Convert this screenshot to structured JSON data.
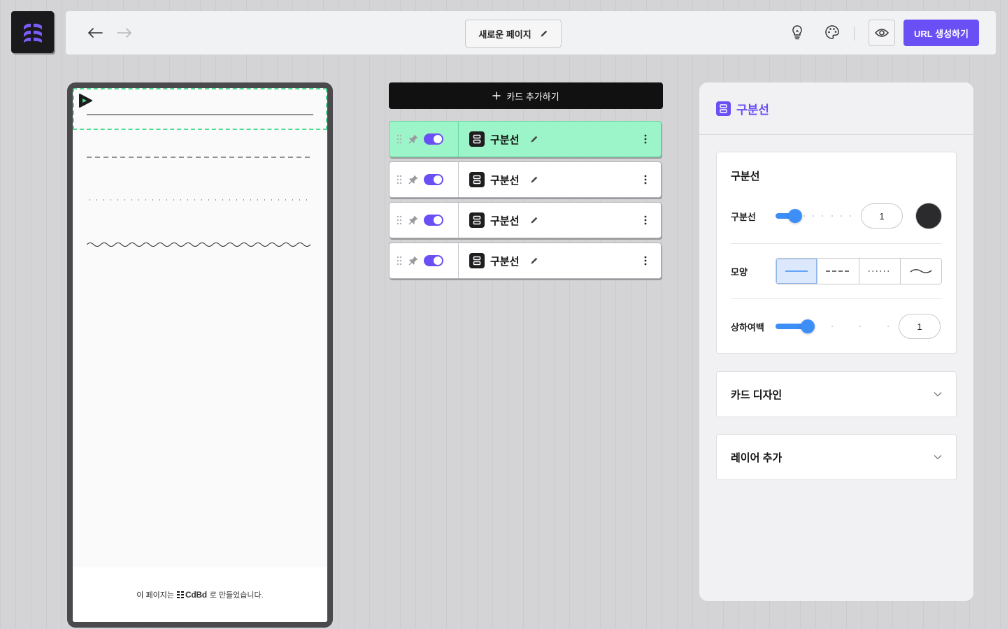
{
  "topbar": {
    "page_title": "새로운 페이지",
    "url_button": "URL 생성하기"
  },
  "colors": {
    "accent": "#6a4ff5",
    "active_card": "#9cf5c8",
    "slider": "#3d8ef7",
    "divider_color": "#2b2b2d"
  },
  "cards": {
    "add_button": "카드 추가하기",
    "items": [
      {
        "title": "구분선",
        "active": true,
        "enabled": true
      },
      {
        "title": "구분선",
        "active": false,
        "enabled": true
      },
      {
        "title": "구분선",
        "active": false,
        "enabled": true
      },
      {
        "title": "구분선",
        "active": false,
        "enabled": true
      }
    ]
  },
  "preview": {
    "dividers": [
      "solid",
      "dashed",
      "dotted",
      "wave"
    ],
    "footer": {
      "prefix": "이 페이지는",
      "brand": "CdBd",
      "suffix": "로 만들었습니다."
    }
  },
  "panel": {
    "title": "구분선",
    "divider_section": {
      "heading": "구분선",
      "thickness_label": "구분선",
      "thickness_value": "1",
      "thickness_fraction": 0.2,
      "shape_label": "모양",
      "shape_options": [
        "solid",
        "dashed",
        "dotted",
        "wave"
      ],
      "shape_selected": "solid",
      "margin_label": "상하여백",
      "margin_value": "1",
      "margin_fraction": 0.25
    },
    "card_design": "카드 디자인",
    "add_layer": "레이어 추가"
  }
}
